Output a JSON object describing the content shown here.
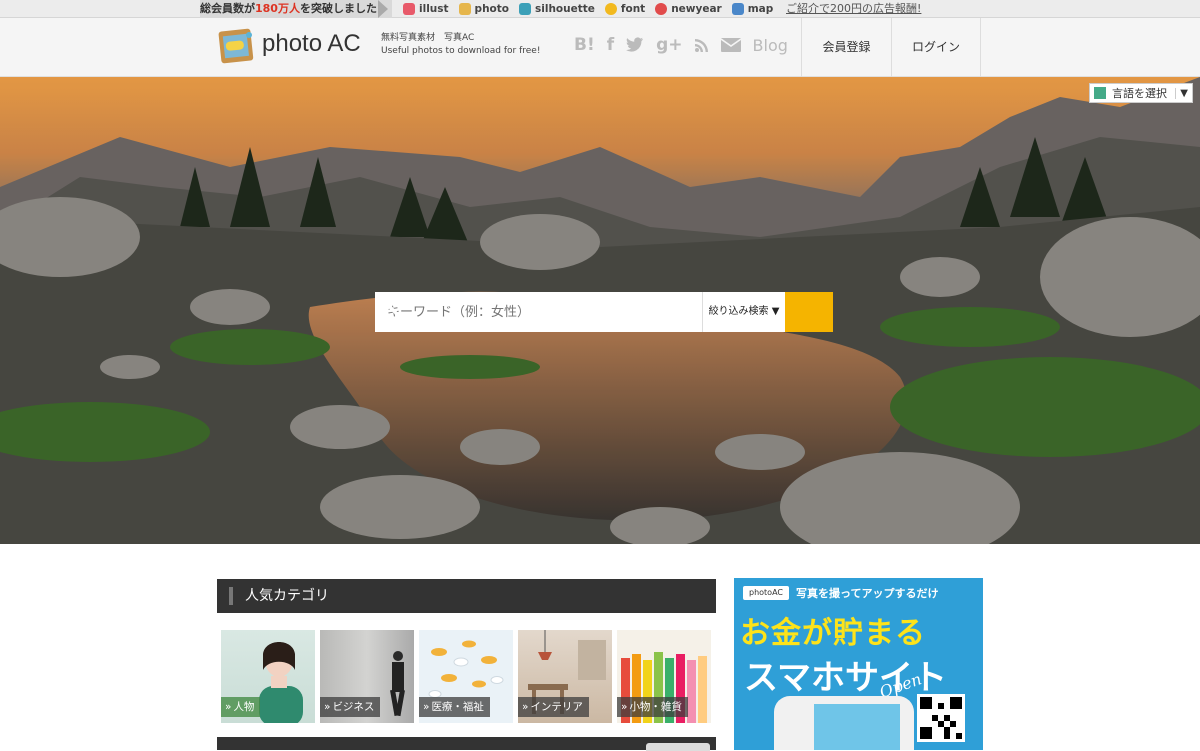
{
  "topbar": {
    "count_prefix": "総会員数が",
    "count_num": "180万人",
    "count_suffix": "を突破しました!",
    "sites": [
      {
        "label": "illust",
        "icon": "illust-icon",
        "color": "#e85a6a"
      },
      {
        "label": "photo",
        "icon": "photo-icon",
        "color": "#e6b64c"
      },
      {
        "label": "silhouette",
        "icon": "silhouette-icon",
        "color": "#3ca0b8"
      },
      {
        "label": "font",
        "icon": "font-icon",
        "color": "#f2b91e"
      },
      {
        "label": "newyear",
        "icon": "newyear-icon",
        "color": "#e14b4b"
      },
      {
        "label": "map",
        "icon": "map-icon",
        "color": "#4a87c9"
      }
    ],
    "promo": "ご紹介で200円の広告報酬!"
  },
  "header": {
    "logo_text": "photo AC",
    "sub1": "無料写真素材　写真AC",
    "sub2": "Useful photos to download for free!",
    "social": [
      "B!",
      "f",
      "t",
      "g+",
      "rss",
      "mail"
    ],
    "blog": "Blog",
    "register": "会員登録",
    "login": "ログイン"
  },
  "hero": {
    "lang": "言語を選択",
    "lang_arrow": "▼",
    "search_placeholder": "キーワード（例：女性）",
    "filter": "絞り込み検索 ▼"
  },
  "categories": {
    "title": "人気カテゴリ",
    "items": [
      {
        "label": "人物",
        "accent": "green"
      },
      {
        "label": "ビジネス",
        "accent": "dark"
      },
      {
        "label": "医療・福祉",
        "accent": "dark"
      },
      {
        "label": "インテリア",
        "accent": "dark"
      },
      {
        "label": "小物・雑貨",
        "accent": "dark"
      }
    ]
  },
  "ad": {
    "tag": "photoAC",
    "line1": "写真を撮ってアップするだけ",
    "line2": "お金が貯まる",
    "line3": "スマホサイト",
    "line4": "Open"
  }
}
